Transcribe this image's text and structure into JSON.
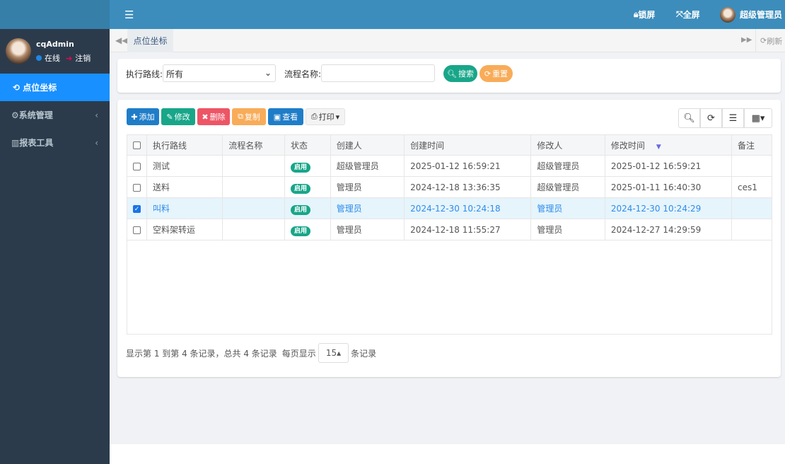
{
  "header": {
    "lock": "锁屏",
    "fullscreen": "全屏",
    "user": "超级管理员"
  },
  "sidebar": {
    "username": "cqAdmin",
    "status": "在线",
    "logout": "注销",
    "items": [
      {
        "label": "点位坐标",
        "icon": "refresh-icon",
        "active": true
      },
      {
        "label": "系统管理",
        "icon": "gear-icon"
      },
      {
        "label": "报表工具",
        "icon": "barcode-icon"
      }
    ]
  },
  "tabs": {
    "items": [
      "点位坐标"
    ],
    "refresh": "刷新"
  },
  "search": {
    "route_label": "执行路线:",
    "route_value": "所有",
    "flow_label": "流程名称:",
    "flow_value": "",
    "search_btn": "搜索",
    "reset_btn": "重置"
  },
  "toolbar": {
    "add": "添加",
    "edit": "修改",
    "delete": "删除",
    "copy": "复制",
    "view": "查看",
    "print": "打印"
  },
  "colors": {
    "topbar": "#3c8dbc",
    "sidebar": "#2c3b4c",
    "active": "#1890ff",
    "add": "#1f7dc8",
    "edit": "#18a689",
    "delete": "#ed5565",
    "copy": "#f8ac59",
    "search": "#18a689",
    "reset": "#f8ac59"
  },
  "table": {
    "headers": [
      "执行路线",
      "流程名称",
      "状态",
      "创建人",
      "创建时间",
      "修改人",
      "修改时间",
      "备注"
    ],
    "rows": [
      {
        "checked": false,
        "route": "测试",
        "flow": "",
        "status": "启用",
        "creator": "超级管理员",
        "created": "2025-01-12 16:59:21",
        "modifier": "超级管理员",
        "modified": "2025-01-12 16:59:21",
        "note": ""
      },
      {
        "checked": false,
        "route": "送料",
        "flow": "",
        "status": "启用",
        "creator": "管理员",
        "created": "2024-12-18 13:36:35",
        "modifier": "超级管理员",
        "modified": "2025-01-11 16:40:30",
        "note": "ces1"
      },
      {
        "checked": true,
        "route": "叫料",
        "flow": "",
        "status": "启用",
        "creator": "管理员",
        "created": "2024-12-30 10:24:18",
        "modifier": "管理员",
        "modified": "2024-12-30 10:24:29",
        "note": ""
      },
      {
        "checked": false,
        "route": "空料架转运",
        "flow": "",
        "status": "启用",
        "creator": "管理员",
        "created": "2024-12-18 11:55:27",
        "modifier": "管理员",
        "modified": "2024-12-27 14:29:59",
        "note": ""
      }
    ]
  },
  "pager": {
    "summary": "显示第 1 到第 4 条记录，总共 4 条记录",
    "per_page_label": "每页显示",
    "per_page": "15",
    "suffix": "条记录"
  }
}
